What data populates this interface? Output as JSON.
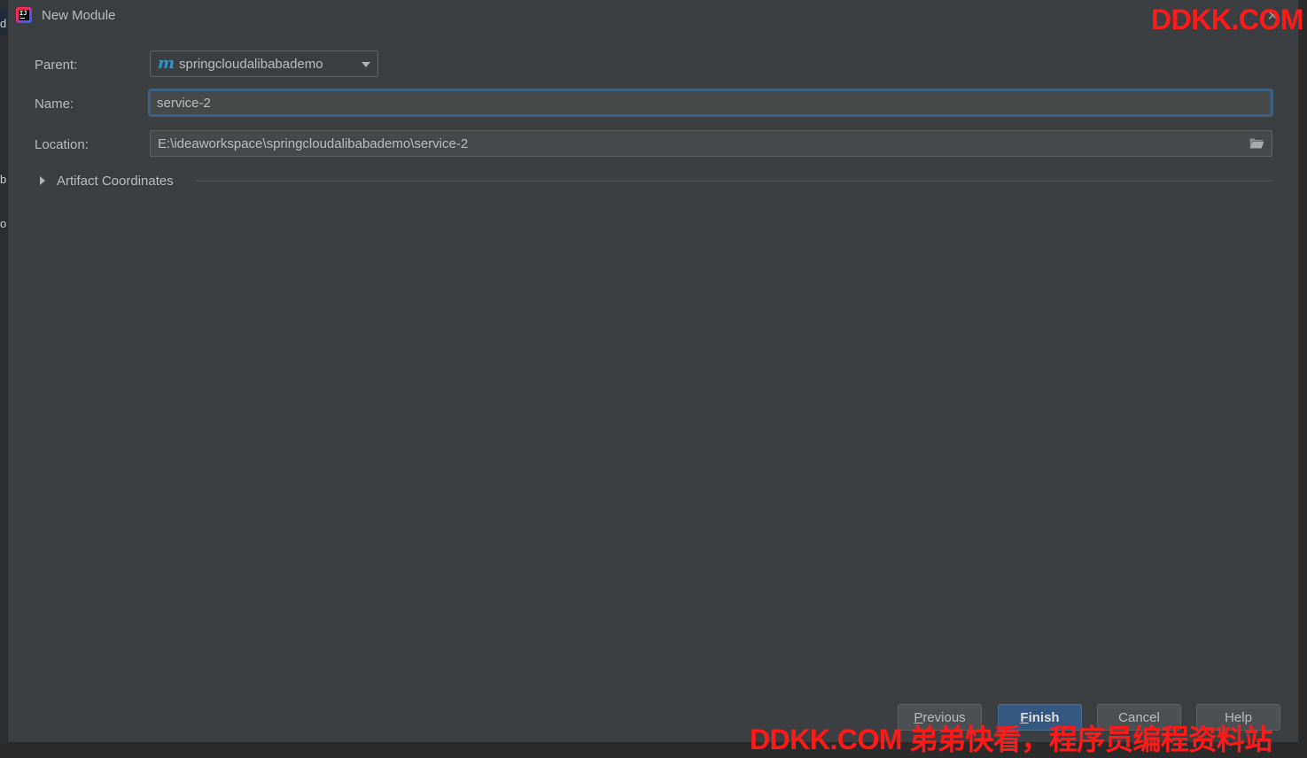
{
  "window": {
    "title": "New Module",
    "icon": "intellij-idea-icon",
    "close_glyph": "✕"
  },
  "background": {
    "edge_letters": [
      "d",
      "b",
      "ol"
    ]
  },
  "form": {
    "parent": {
      "label": "Parent:",
      "icon": "maven-m-icon",
      "icon_glyph": "m",
      "value": "springcloudalibabademo"
    },
    "name": {
      "label": "Name:",
      "value": "service-2"
    },
    "location": {
      "label": "Location:",
      "value": "E:\\ideaworkspace\\springcloudalibabademo\\service-2",
      "icon": "folder-icon"
    },
    "artifact": {
      "label": "Artifact Coordinates",
      "expanded": false
    }
  },
  "buttons": {
    "previous": {
      "label_mnemonic": "P",
      "label_rest": "revious"
    },
    "finish": {
      "label_mnemonic": "F",
      "label_rest": "inish"
    },
    "cancel": "Cancel",
    "help": "Help"
  },
  "watermark": {
    "top": "DDKK.COM",
    "bottom": "DDKK.COM 弟弟快看，程序员编程资料站",
    "color": "#ff1a1a"
  },
  "colors": {
    "dialog_bg": "#3c3f41",
    "accent_focus": "#3d6185",
    "primary_button": "#365880",
    "text": "#bbbbbb"
  }
}
